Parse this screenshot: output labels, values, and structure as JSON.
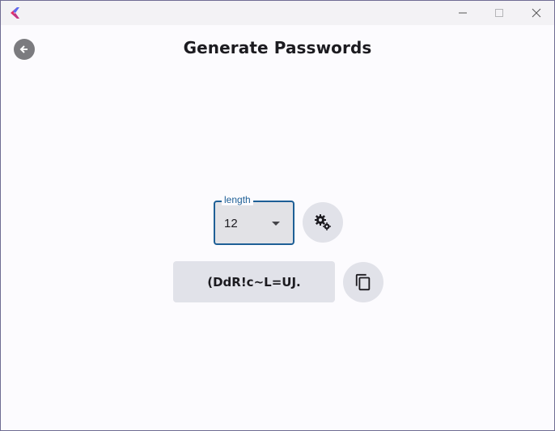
{
  "window": {
    "title": "",
    "controls": {
      "minimize_icon": "minimize-icon",
      "maximize_icon": "maximize-icon",
      "close_icon": "close-icon"
    }
  },
  "header": {
    "back_icon": "arrow-left-icon",
    "title": "Generate Passwords"
  },
  "length_select": {
    "label": "length",
    "value": "12",
    "accent_color": "#1e5f96"
  },
  "settings_button": {
    "icon": "gears-icon"
  },
  "password": {
    "value": "(DdR!c~L=UJ."
  },
  "copy_button": {
    "icon": "copy-icon"
  },
  "colors": {
    "background": "#fcfbfe",
    "surface": "#e1e2e9",
    "text": "#1c1b20"
  }
}
